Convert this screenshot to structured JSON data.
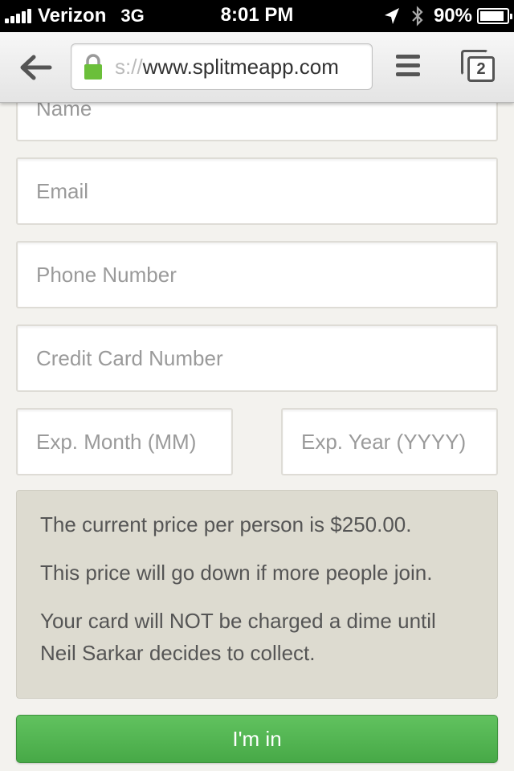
{
  "status_bar": {
    "carrier": "Verizon",
    "network": "3G",
    "time": "8:01 PM",
    "battery_percent": "90%",
    "battery_level": 0.9,
    "icons": [
      "signal-icon",
      "location-arrow-icon",
      "bluetooth-icon",
      "battery-icon"
    ]
  },
  "browser": {
    "url_scheme": "s://",
    "url_host": "www.splitmeapp.com",
    "tab_count": "2",
    "icons": [
      "back-arrow-icon",
      "lock-icon",
      "menu-icon",
      "tabs-icon"
    ],
    "lock_color": "#6bbf3a"
  },
  "form": {
    "name_placeholder": "Name",
    "email_placeholder": "Email",
    "phone_placeholder": "Phone Number",
    "card_placeholder": "Credit Card Number",
    "month_placeholder": "Exp. Month (MM)",
    "year_placeholder": "Exp. Year (YYYY)"
  },
  "info": {
    "line1": "The current price per person is $250.00.",
    "line2": "This price will go down if more people join.",
    "line3": "Your card will NOT be charged a dime until Neil Sarkar decides to collect."
  },
  "submit_label": "I'm in",
  "colors": {
    "accent_green": "#52b552",
    "page_background": "#f3f2ee",
    "info_background": "#dddbd0"
  }
}
